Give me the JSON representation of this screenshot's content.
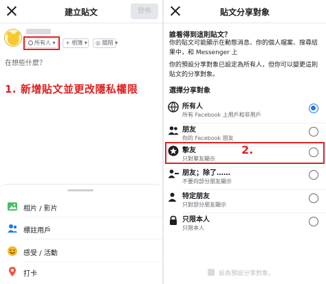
{
  "left": {
    "header": {
      "title": "建立貼文",
      "post_label": "發佈"
    },
    "audience_label": "所有人",
    "album_label": "+ 相簿",
    "instagram_label": "關閉",
    "placeholder": "在想些什麼？",
    "annotation": "1. 新增貼文並更改隱私權限",
    "options": [
      {
        "label": "相片 / 影片",
        "icon": "photo-icon"
      },
      {
        "label": "標註用戶",
        "icon": "tag-people-icon"
      },
      {
        "label": "感受 / 活動",
        "icon": "feeling-icon"
      },
      {
        "label": "打卡",
        "icon": "check-in-icon"
      }
    ]
  },
  "right": {
    "header": {
      "title": "貼文分享對象"
    },
    "question": "誰看得到這則貼文？",
    "desc1": "你的貼文可能顯示在動態消息、你的個人檔案、搜尋結果中，和 Messenger 上",
    "desc2": "你的預設分享對象已設定為所有人，但你可以變更這則貼文的分享對象。",
    "section": "選擇分享對象",
    "rows": [
      {
        "title": "所有人",
        "sub": "所有 Facebook 上用戶和非用戶",
        "icon": "globe-icon",
        "selected": true
      },
      {
        "title": "朋友",
        "sub": "你的 Facebook 朋友",
        "icon": "friends-icon",
        "selected": false
      },
      {
        "title": "摯友",
        "sub": "只對摯友顯示",
        "icon": "star-icon",
        "selected": false
      },
      {
        "title": "朋友；除了……",
        "sub": "不要向部分朋友顯示",
        "icon": "friends-except-icon",
        "selected": false
      },
      {
        "title": "特定朋友",
        "sub": "只對部分朋友顯示",
        "icon": "specific-friends-icon",
        "selected": false
      },
      {
        "title": "只限本人",
        "sub": "只限本人",
        "icon": "lock-icon",
        "selected": false
      }
    ],
    "annotation": "2.",
    "default_label": "設為預設分享對象。"
  },
  "colors": {
    "accent": "#1877f2",
    "annotation_red": "#e02020"
  }
}
